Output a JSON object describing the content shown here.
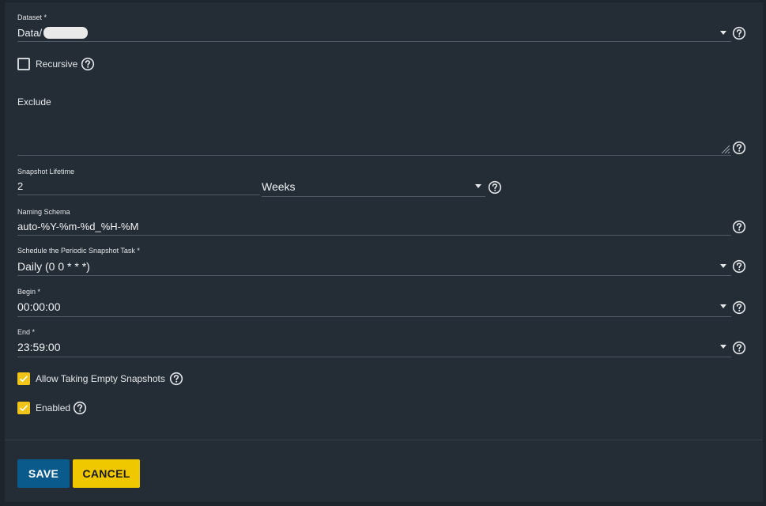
{
  "colors": {
    "background": "#242c35",
    "checkbox_checked": "#f0c419",
    "save_button": "#0a5a8c",
    "cancel_button": "#f0c800"
  },
  "form": {
    "dataset": {
      "label": "Dataset *",
      "value": "Data/"
    },
    "recursive": {
      "label": "Recursive",
      "checked": false
    },
    "exclude": {
      "label": "Exclude",
      "value": ""
    },
    "snapshot_lifetime": {
      "label": "Snapshot Lifetime",
      "value": "2",
      "unit": "Weeks"
    },
    "naming_schema": {
      "label": "Naming Schema",
      "value": "auto-%Y-%m-%d_%H-%M"
    },
    "schedule": {
      "label": "Schedule the Periodic Snapshot Task *",
      "value": "Daily (0 0 * * *)"
    },
    "begin": {
      "label": "Begin *",
      "value": "00:00:00"
    },
    "end": {
      "label": "End *",
      "value": "23:59:00"
    },
    "allow_empty": {
      "label": "Allow Taking Empty Snapshots",
      "checked": true
    },
    "enabled": {
      "label": "Enabled",
      "checked": true
    }
  },
  "actions": {
    "save_label": "SAVE",
    "cancel_label": "CANCEL"
  }
}
